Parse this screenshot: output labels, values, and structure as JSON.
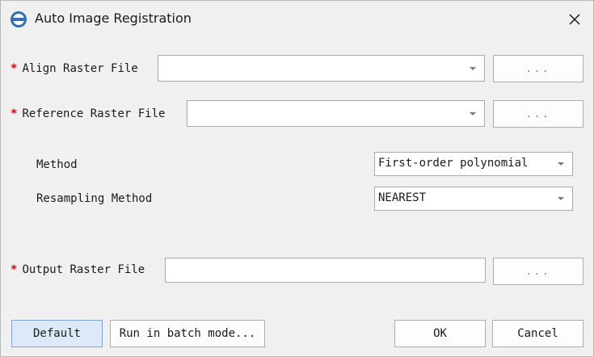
{
  "window": {
    "title": "Auto Image Registration",
    "icon": "app-logo-icon",
    "close_icon": "close-icon"
  },
  "form": {
    "required_marker": "*",
    "align_raster": {
      "label": "Align Raster File",
      "value": "",
      "browse_label": "..."
    },
    "reference_raster": {
      "label": "Reference Raster File",
      "value": "",
      "browse_label": "..."
    },
    "method": {
      "label": "Method",
      "value": "First-order polynomial"
    },
    "resampling_method": {
      "label": "Resampling Method",
      "value": "NEAREST"
    },
    "output_raster": {
      "label": "Output Raster File",
      "value": "",
      "browse_label": "..."
    }
  },
  "buttons": {
    "default": "Default",
    "batch": "Run in batch mode...",
    "ok": "OK",
    "cancel": "Cancel"
  },
  "colors": {
    "required": "#e00000",
    "default_button_bg": "#dbe9f8"
  }
}
